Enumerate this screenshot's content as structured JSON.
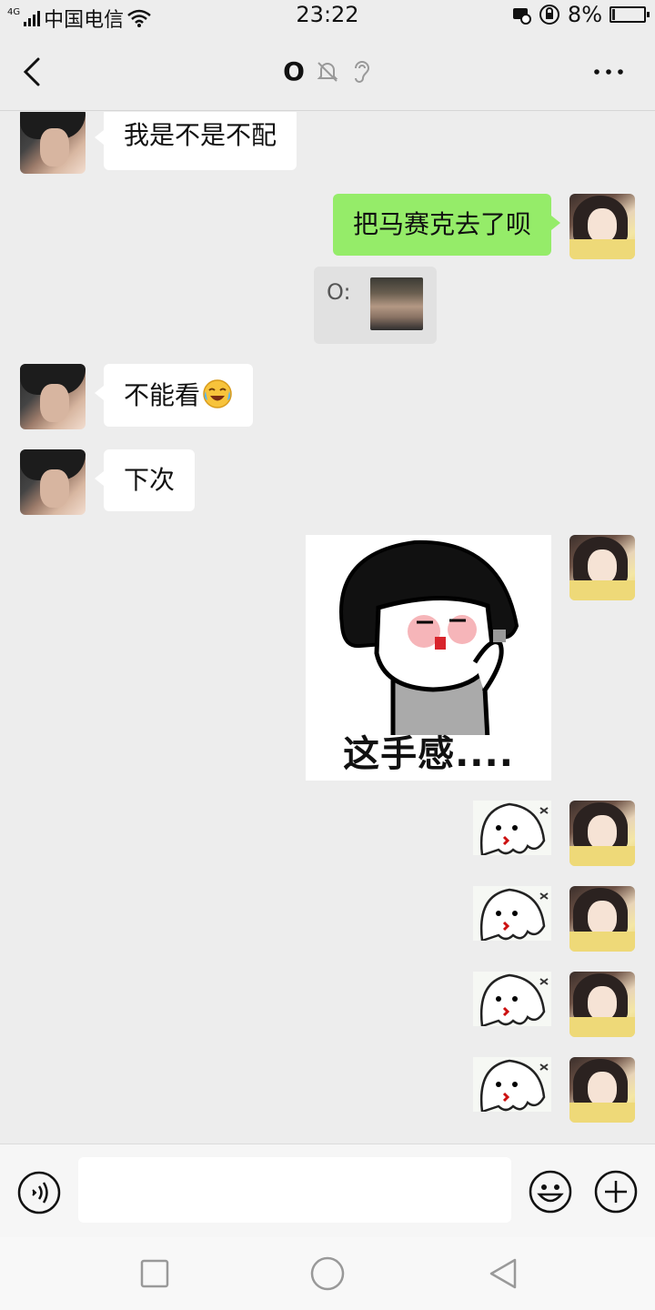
{
  "status_bar": {
    "network": "4G",
    "carrier": "中国电信",
    "time": "23:22",
    "battery_percent_label": "8%",
    "battery_level": 0.08
  },
  "header": {
    "title": "O",
    "back_icon": "chevron-left-icon",
    "mute_icon": "bell-off-icon",
    "earpiece_icon": "ear-icon",
    "more_icon": "more-dots-icon"
  },
  "messages": [
    {
      "sender": "other",
      "text": "我是不是不配"
    },
    {
      "sender": "self",
      "text": "把马赛克去了呗"
    },
    {
      "sender": "self",
      "type": "quote",
      "quote_label": "O:"
    },
    {
      "sender": "other",
      "text": "不能看",
      "emoji": "crying-laughing-emoji"
    },
    {
      "sender": "other",
      "text": "下次"
    },
    {
      "sender": "self",
      "type": "sticker",
      "caption": "这手感...."
    },
    {
      "sender": "self",
      "type": "sticker-small"
    },
    {
      "sender": "self",
      "type": "sticker-small"
    },
    {
      "sender": "self",
      "type": "sticker-small"
    },
    {
      "sender": "self",
      "type": "sticker-small"
    }
  ],
  "input_bar": {
    "text_value": "",
    "voice_icon": "voice-icon",
    "emoji_icon": "smile-icon",
    "plus_icon": "plus-icon"
  },
  "colors": {
    "background": "#ededed",
    "self_bubble": "#95ec69",
    "other_bubble": "#ffffff"
  }
}
